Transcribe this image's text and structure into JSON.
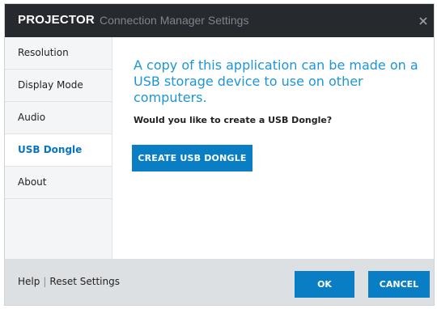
{
  "window": {
    "brand": "PROJECTOR",
    "title": "Connection Manager Settings",
    "close_icon": "close-icon"
  },
  "sidebar": {
    "items": [
      {
        "label": "Resolution",
        "active": false
      },
      {
        "label": "Display Mode",
        "active": false
      },
      {
        "label": "Audio",
        "active": false
      },
      {
        "label": "USB Dongle",
        "active": true
      },
      {
        "label": "About",
        "active": false
      }
    ]
  },
  "content": {
    "heading": "A copy of this application can be made on a USB storage device to use on other computers.",
    "question": "Would you like to create a USB Dongle?",
    "create_button": "CREATE USB DONGLE"
  },
  "footer": {
    "help": "Help",
    "separator": "|",
    "reset": "Reset Settings",
    "ok": "OK",
    "cancel": "CANCEL"
  },
  "colors": {
    "titlebar": "#262a2e",
    "accent": "#0a7ec5",
    "heading": "#1d95d6",
    "active_nav": "#0874c2",
    "footer": "#dde0e3"
  }
}
